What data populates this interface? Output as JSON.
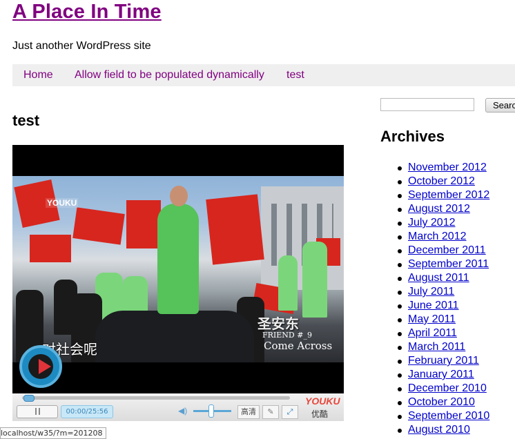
{
  "site": {
    "title": "A Place In Time",
    "tagline": "Just another WordPress site"
  },
  "nav": {
    "items": [
      "Home",
      "Allow field to be populated dynamically",
      "test"
    ]
  },
  "post": {
    "title": "test"
  },
  "video": {
    "logo": "YOUKU",
    "subtitle": "对社会呢",
    "watermark_title": "圣安东",
    "watermark_sub": "FRIEND #_9",
    "watermark_en": "Come Across",
    "time": "00:00/25:56",
    "hd_label": "高清",
    "brand": "YOUKU",
    "brand_cn": "优酷"
  },
  "sidebar": {
    "search_button": "Search",
    "archives_title": "Archives",
    "archives": [
      "November 2012",
      "October 2012",
      "September 2012",
      "August 2012",
      "July 2012",
      "March 2012",
      "December 2011",
      "September 2011",
      "August 2011",
      "July 2011",
      "June 2011",
      "May 2011",
      "April 2011",
      "March 2011",
      "February 2011",
      "January 2011",
      "December 2010",
      "October 2010",
      "September 2010",
      "August 2010"
    ]
  },
  "status_bar": {
    "url": "localhost/w35/?m=201208"
  },
  "colors": {
    "link_visited": "#800080",
    "link": "#0000cc",
    "nav_bg": "#efefef"
  }
}
